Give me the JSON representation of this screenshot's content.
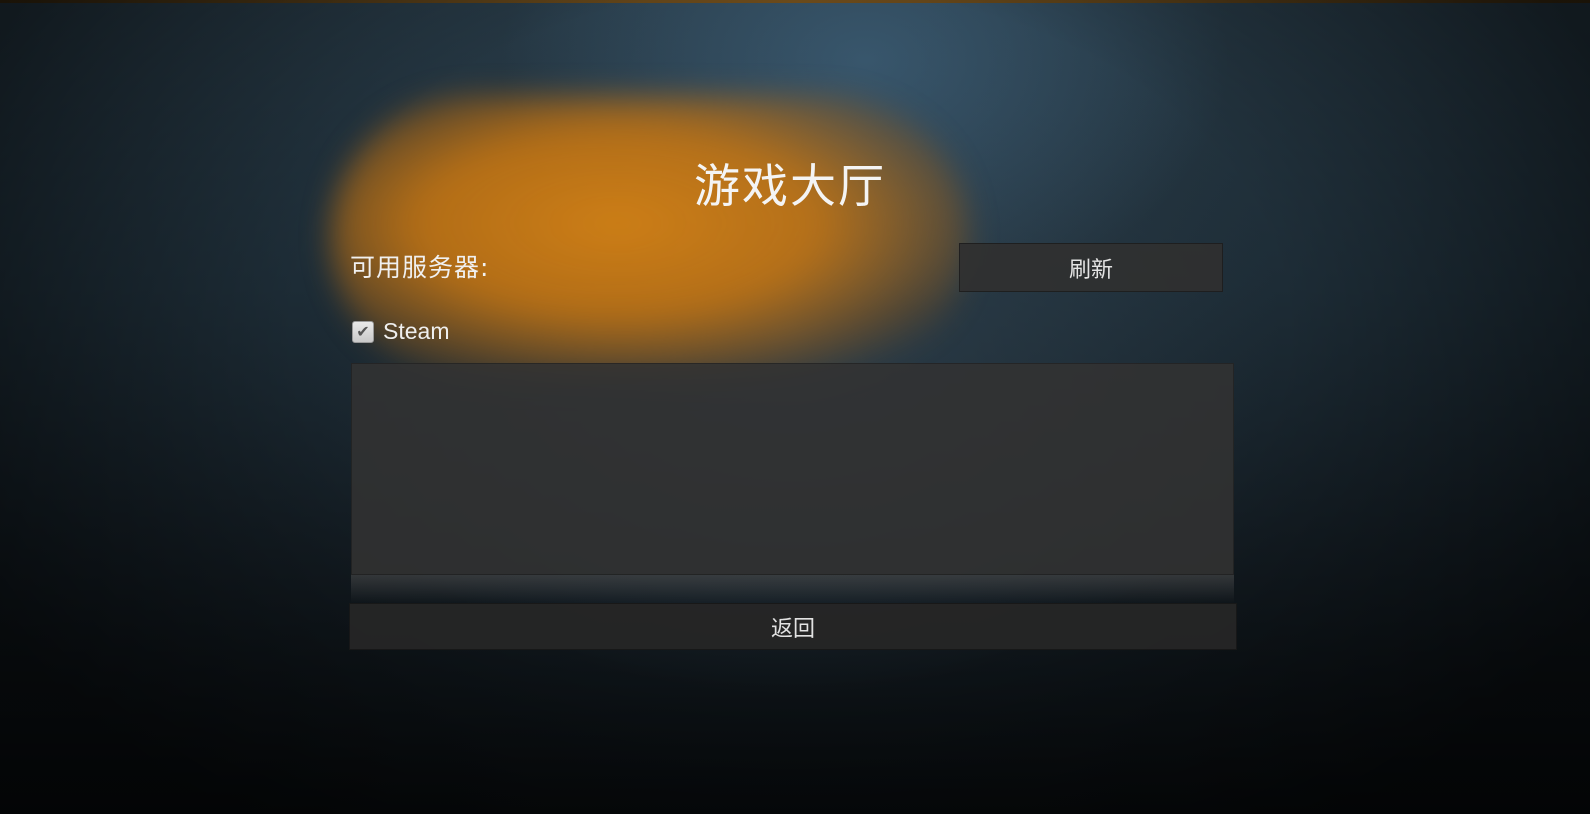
{
  "lobby": {
    "title": "游戏大厅",
    "servers_label": "可用服务器:",
    "refresh_label": "刷新",
    "steam_filter": {
      "label": "Steam",
      "checked": true,
      "check_glyph": "✔"
    },
    "server_list": {
      "rows": []
    },
    "back_label": "返回"
  },
  "colors": {
    "accent_glow": "#d4821a",
    "panel": "#323232",
    "button": "#303030",
    "background_top": "#263844",
    "background_bottom": "#070a0c"
  }
}
